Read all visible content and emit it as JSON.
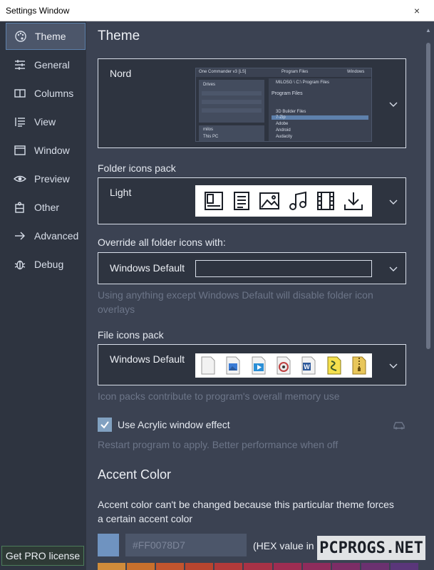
{
  "window": {
    "title": "Settings Window",
    "close_glyph": "×"
  },
  "sidebar": {
    "items": [
      {
        "label": "Theme",
        "icon": "palette-icon",
        "active": true
      },
      {
        "label": "General",
        "icon": "sliders-icon"
      },
      {
        "label": "Columns",
        "icon": "columns-icon"
      },
      {
        "label": "View",
        "icon": "list-icon"
      },
      {
        "label": "Window",
        "icon": "window-icon"
      },
      {
        "label": "Preview",
        "icon": "eye-icon"
      },
      {
        "label": "Other",
        "icon": "puzzle-icon"
      },
      {
        "label": "Advanced",
        "icon": "arrow-right-icon"
      },
      {
        "label": "Debug",
        "icon": "bug-icon"
      }
    ],
    "pro_button": "Get PRO license"
  },
  "main": {
    "heading": "Theme",
    "theme": {
      "value": "Nord",
      "preview": {
        "app_title": "One Commander v3 [LS]",
        "tab1": "Program Files",
        "tab2": "Windows",
        "drives_label": "Drives",
        "path": "MILOSG \\ C:\\ Program Files",
        "folder_title": "Program Files",
        "user_label": "milos",
        "pc_label": "This PC",
        "rows": [
          "3D Builder Files",
          "7-Zip",
          "Adobe",
          "Android",
          "Audacity"
        ]
      }
    },
    "folder_icons": {
      "label": "Folder icons pack",
      "value": "Light"
    },
    "override": {
      "label": "Override all folder icons with:",
      "value": "Windows Default",
      "hint": "Using anything except Windows Default will disable folder icon overlays"
    },
    "file_icons": {
      "label": "File icons pack",
      "value": "Windows Default",
      "hint": "Icon packs contribute to program's overall memory use"
    },
    "acrylic": {
      "label": "Use Acrylic window effect",
      "checked": true,
      "hint": "Restart program to apply. Better performance when off"
    },
    "accent": {
      "heading": "Accent Color",
      "note": "Accent color can't be changed because this particular theme forces a certain accent color",
      "hex_value": "#FF0078D7",
      "hex_label": "(HEX value in",
      "swatch_color": "#6f93c0",
      "palette": [
        "#d08c3a",
        "#c8702c",
        "#c2552e",
        "#b8452f",
        "#b33a3a",
        "#a83246",
        "#9e2d52",
        "#8e2c5c",
        "#7c2d66",
        "#6b3170",
        "#5a367a"
      ]
    }
  },
  "watermark": "PCPROGS.NET"
}
